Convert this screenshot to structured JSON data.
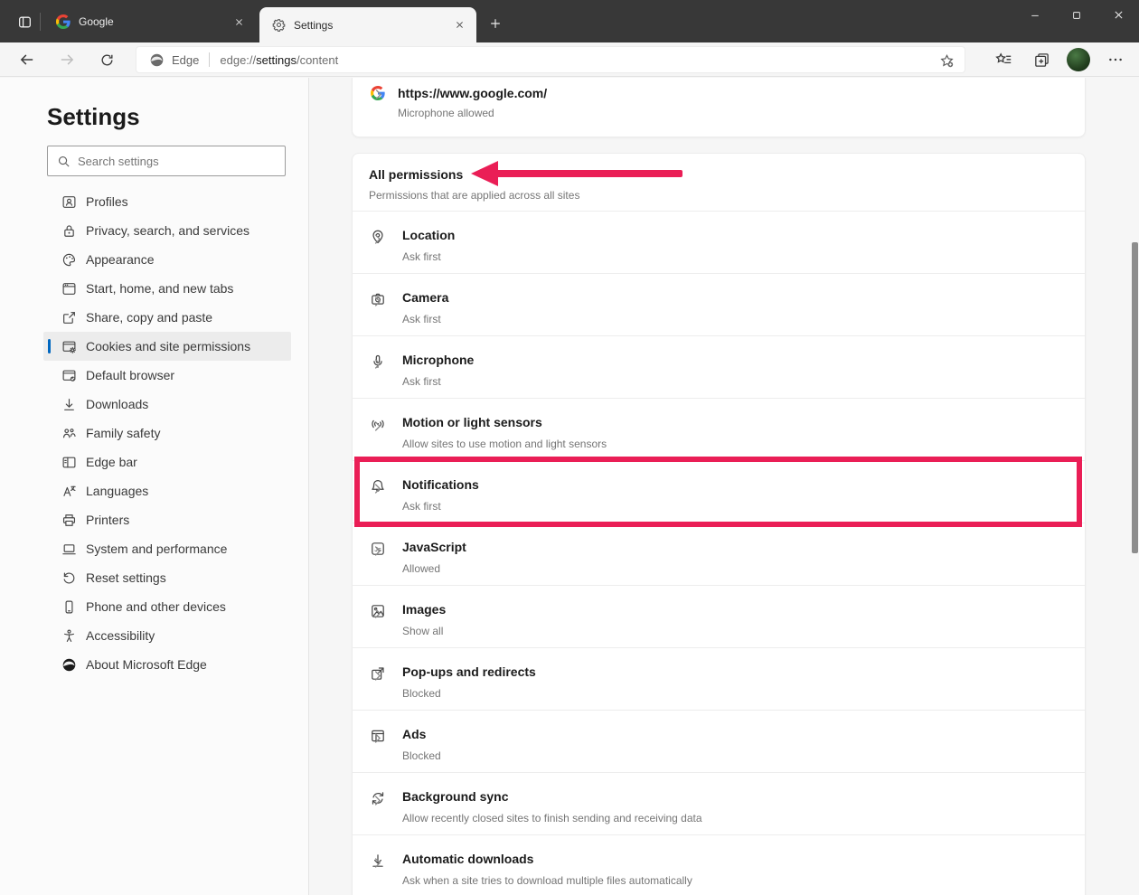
{
  "colors": {
    "accent_blue": "#0067c0",
    "annotation_red": "#ea1e56",
    "titlebar_bg": "#383838"
  },
  "titlebar": {
    "tabs": [
      {
        "label": "Google",
        "icon": "google-favicon",
        "active": false
      },
      {
        "label": "Settings",
        "icon": "gear-icon",
        "active": true
      }
    ]
  },
  "toolbar": {
    "site_chip": "Edge",
    "url": {
      "scheme": "edge://",
      "highlight": "settings",
      "path": "/content"
    }
  },
  "sidebar": {
    "title": "Settings",
    "search_placeholder": "Search settings",
    "items": [
      {
        "label": "Profiles",
        "icon": "profiles-icon"
      },
      {
        "label": "Privacy, search, and services",
        "icon": "privacy-lock-icon"
      },
      {
        "label": "Appearance",
        "icon": "appearance-icon"
      },
      {
        "label": "Start, home, and new tabs",
        "icon": "start-home-icon"
      },
      {
        "label": "Share, copy and paste",
        "icon": "share-icon"
      },
      {
        "label": "Cookies and site permissions",
        "icon": "cookies-permissions-icon",
        "selected": true
      },
      {
        "label": "Default browser",
        "icon": "default-browser-icon"
      },
      {
        "label": "Downloads",
        "icon": "downloads-icon"
      },
      {
        "label": "Family safety",
        "icon": "family-safety-icon"
      },
      {
        "label": "Edge bar",
        "icon": "edge-bar-icon"
      },
      {
        "label": "Languages",
        "icon": "languages-icon"
      },
      {
        "label": "Printers",
        "icon": "printers-icon"
      },
      {
        "label": "System and performance",
        "icon": "system-performance-icon"
      },
      {
        "label": "Reset settings",
        "icon": "reset-settings-icon"
      },
      {
        "label": "Phone and other devices",
        "icon": "phone-devices-icon"
      },
      {
        "label": "Accessibility",
        "icon": "accessibility-icon"
      },
      {
        "label": "About Microsoft Edge",
        "icon": "edge-logo-icon"
      }
    ]
  },
  "content": {
    "site_row": {
      "url": "https://www.google.com/",
      "status": "Microphone allowed",
      "icon": "google-favicon"
    },
    "section": {
      "title": "All permissions",
      "subtitle": "Permissions that are applied across all sites"
    },
    "permissions": [
      {
        "name": "Location",
        "status": "Ask first",
        "icon": "location-icon"
      },
      {
        "name": "Camera",
        "status": "Ask first",
        "icon": "camera-icon"
      },
      {
        "name": "Microphone",
        "status": "Ask first",
        "icon": "microphone-icon"
      },
      {
        "name": "Motion or light sensors",
        "status": "Allow sites to use motion and light sensors",
        "icon": "motion-sensors-icon"
      },
      {
        "name": "Notifications",
        "status": "Ask first",
        "icon": "notifications-bell-icon",
        "highlighted": true
      },
      {
        "name": "JavaScript",
        "status": "Allowed",
        "icon": "javascript-icon"
      },
      {
        "name": "Images",
        "status": "Show all",
        "icon": "images-icon"
      },
      {
        "name": "Pop-ups and redirects",
        "status": "Blocked",
        "icon": "popups-icon"
      },
      {
        "name": "Ads",
        "status": "Blocked",
        "icon": "ads-icon"
      },
      {
        "name": "Background sync",
        "status": "Allow recently closed sites to finish sending and receiving data",
        "icon": "background-sync-icon"
      },
      {
        "name": "Automatic downloads",
        "status": "Ask when a site tries to download multiple files automatically",
        "icon": "automatic-downloads-icon"
      }
    ]
  }
}
